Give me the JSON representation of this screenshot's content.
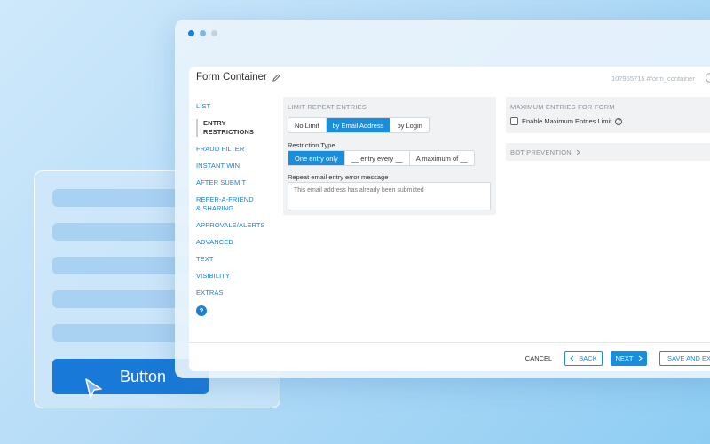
{
  "background_card": {
    "button_label": "Button"
  },
  "panel": {
    "title": "Form Container",
    "id_text": "107965715 #form_container"
  },
  "sidenav": {
    "items": [
      "LIST",
      "ENTRY RESTRICTIONS",
      "FRAUD FILTER",
      "INSTANT WIN",
      "AFTER SUBMIT",
      "REFER-A-FRIEND & SHARING",
      "APPROVALS/ALERTS",
      "ADVANCED",
      "TEXT",
      "VISIBILITY",
      "EXTRAS"
    ],
    "active_index": 1,
    "help_label": "?"
  },
  "limit_repeat": {
    "title": "LIMIT REPEAT ENTRIES",
    "options": [
      "No Limit",
      "by Email Address",
      "by Login"
    ],
    "selected": "by Email Address",
    "restriction_type_label": "Restriction Type",
    "restriction_options": [
      "One entry only",
      "__ entry every __",
      "A maximum of __"
    ],
    "restriction_selected": "One entry only",
    "error_message_label": "Repeat email entry error message",
    "error_message_placeholder": "This email address has already been submitted"
  },
  "maximum_entries": {
    "title": "MAXIMUM ENTRIES FOR FORM",
    "checkbox_label": "Enable Maximum Entries Limit",
    "checked": false
  },
  "bot_prevention": {
    "title": "BOT PREVENTION"
  },
  "footer": {
    "cancel": "CANCEL",
    "back": "BACK",
    "next": "NEXT",
    "save_exit": "SAVE AND EXIT"
  },
  "colors": {
    "accent": "#1a8ddb",
    "link": "#1a7fd6",
    "back_button": "#1879d8"
  }
}
